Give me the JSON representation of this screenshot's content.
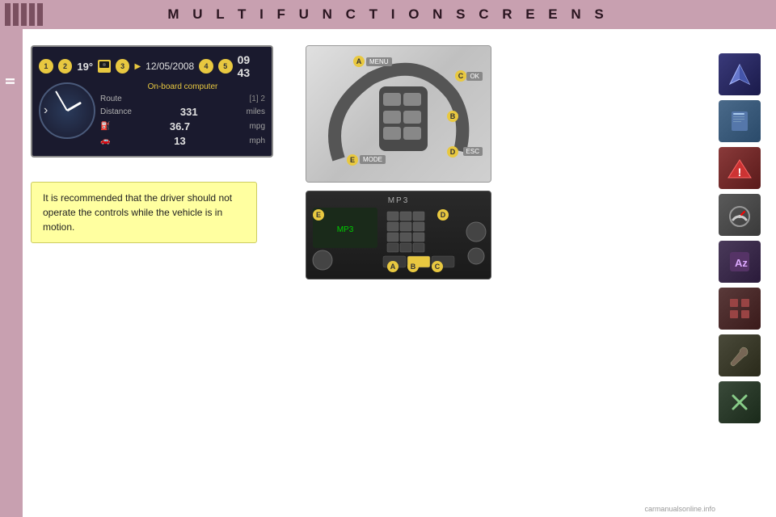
{
  "header": {
    "title": "M U L T I F U N C T I O N   S C R E E N S"
  },
  "chapter": {
    "label": "II"
  },
  "screen": {
    "temp": "19°",
    "date": "12/05/2008",
    "time": "09 43",
    "computer_label": "On-board computer",
    "route_label": "Route",
    "route_tabs": "[1] 2",
    "distance_label": "Distance",
    "distance_value": "331",
    "distance_unit": "miles",
    "fuel_value": "36.7",
    "fuel_unit": "mpg",
    "speed_value": "13",
    "speed_unit": "mph",
    "indicators": [
      "1",
      "2",
      "3",
      "4",
      "5"
    ]
  },
  "steering": {
    "labels": {
      "A": "A",
      "B": "B",
      "C": "C",
      "D": "D",
      "E": "E"
    },
    "menu_label": "MENU",
    "mode_label": "MODE",
    "ok_label": "OK",
    "esc_label": "ESC"
  },
  "radio": {
    "title": "MP3",
    "labels": {
      "A": "A",
      "B": "B",
      "C": "C",
      "D": "D",
      "E": "E"
    }
  },
  "warning": {
    "text": "It is recommended that the driver should not operate the controls while the vehicle is in motion."
  },
  "sidebar_icons": [
    {
      "id": "nav",
      "symbol": "✦",
      "class": "icon-nav",
      "label": "navigation icon"
    },
    {
      "id": "book",
      "symbol": "📖",
      "class": "icon-book",
      "label": "manual icon"
    },
    {
      "id": "warning",
      "symbol": "⚠",
      "class": "icon-warning",
      "label": "warning icon"
    },
    {
      "id": "gauge",
      "symbol": "⚙",
      "class": "icon-gauge",
      "label": "settings icon"
    },
    {
      "id": "az",
      "symbol": "Az",
      "class": "icon-az",
      "label": "alphabet icon"
    },
    {
      "id": "grid",
      "symbol": "⊞",
      "class": "icon-grid",
      "label": "grid icon"
    },
    {
      "id": "wrench",
      "symbol": "🔧",
      "class": "icon-wrench",
      "label": "wrench icon"
    },
    {
      "id": "tools",
      "symbol": "✕",
      "class": "icon-tools",
      "label": "tools icon"
    }
  ],
  "watermark": {
    "text": "carmanualsonline.info"
  }
}
